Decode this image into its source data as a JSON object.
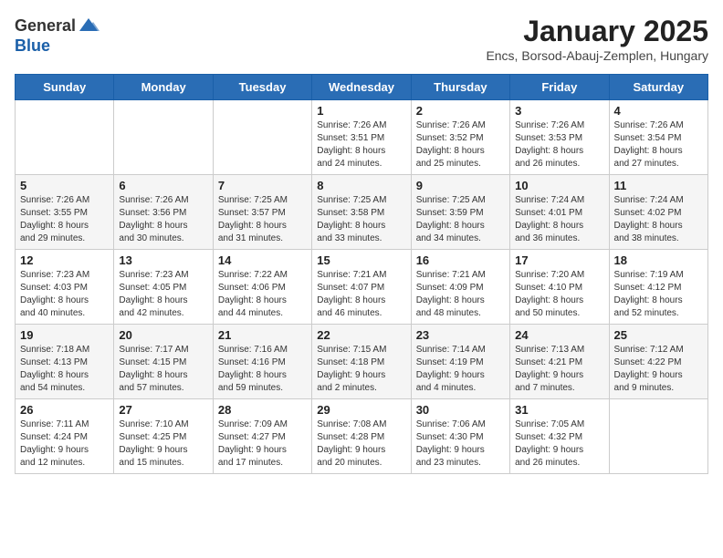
{
  "header": {
    "logo_general": "General",
    "logo_blue": "Blue",
    "month_title": "January 2025",
    "location": "Encs, Borsod-Abauj-Zemplen, Hungary"
  },
  "weekdays": [
    "Sunday",
    "Monday",
    "Tuesday",
    "Wednesday",
    "Thursday",
    "Friday",
    "Saturday"
  ],
  "weeks": [
    [
      {
        "day": "",
        "info": ""
      },
      {
        "day": "",
        "info": ""
      },
      {
        "day": "",
        "info": ""
      },
      {
        "day": "1",
        "info": "Sunrise: 7:26 AM\nSunset: 3:51 PM\nDaylight: 8 hours\nand 24 minutes."
      },
      {
        "day": "2",
        "info": "Sunrise: 7:26 AM\nSunset: 3:52 PM\nDaylight: 8 hours\nand 25 minutes."
      },
      {
        "day": "3",
        "info": "Sunrise: 7:26 AM\nSunset: 3:53 PM\nDaylight: 8 hours\nand 26 minutes."
      },
      {
        "day": "4",
        "info": "Sunrise: 7:26 AM\nSunset: 3:54 PM\nDaylight: 8 hours\nand 27 minutes."
      }
    ],
    [
      {
        "day": "5",
        "info": "Sunrise: 7:26 AM\nSunset: 3:55 PM\nDaylight: 8 hours\nand 29 minutes."
      },
      {
        "day": "6",
        "info": "Sunrise: 7:26 AM\nSunset: 3:56 PM\nDaylight: 8 hours\nand 30 minutes."
      },
      {
        "day": "7",
        "info": "Sunrise: 7:25 AM\nSunset: 3:57 PM\nDaylight: 8 hours\nand 31 minutes."
      },
      {
        "day": "8",
        "info": "Sunrise: 7:25 AM\nSunset: 3:58 PM\nDaylight: 8 hours\nand 33 minutes."
      },
      {
        "day": "9",
        "info": "Sunrise: 7:25 AM\nSunset: 3:59 PM\nDaylight: 8 hours\nand 34 minutes."
      },
      {
        "day": "10",
        "info": "Sunrise: 7:24 AM\nSunset: 4:01 PM\nDaylight: 8 hours\nand 36 minutes."
      },
      {
        "day": "11",
        "info": "Sunrise: 7:24 AM\nSunset: 4:02 PM\nDaylight: 8 hours\nand 38 minutes."
      }
    ],
    [
      {
        "day": "12",
        "info": "Sunrise: 7:23 AM\nSunset: 4:03 PM\nDaylight: 8 hours\nand 40 minutes."
      },
      {
        "day": "13",
        "info": "Sunrise: 7:23 AM\nSunset: 4:05 PM\nDaylight: 8 hours\nand 42 minutes."
      },
      {
        "day": "14",
        "info": "Sunrise: 7:22 AM\nSunset: 4:06 PM\nDaylight: 8 hours\nand 44 minutes."
      },
      {
        "day": "15",
        "info": "Sunrise: 7:21 AM\nSunset: 4:07 PM\nDaylight: 8 hours\nand 46 minutes."
      },
      {
        "day": "16",
        "info": "Sunrise: 7:21 AM\nSunset: 4:09 PM\nDaylight: 8 hours\nand 48 minutes."
      },
      {
        "day": "17",
        "info": "Sunrise: 7:20 AM\nSunset: 4:10 PM\nDaylight: 8 hours\nand 50 minutes."
      },
      {
        "day": "18",
        "info": "Sunrise: 7:19 AM\nSunset: 4:12 PM\nDaylight: 8 hours\nand 52 minutes."
      }
    ],
    [
      {
        "day": "19",
        "info": "Sunrise: 7:18 AM\nSunset: 4:13 PM\nDaylight: 8 hours\nand 54 minutes."
      },
      {
        "day": "20",
        "info": "Sunrise: 7:17 AM\nSunset: 4:15 PM\nDaylight: 8 hours\nand 57 minutes."
      },
      {
        "day": "21",
        "info": "Sunrise: 7:16 AM\nSunset: 4:16 PM\nDaylight: 8 hours\nand 59 minutes."
      },
      {
        "day": "22",
        "info": "Sunrise: 7:15 AM\nSunset: 4:18 PM\nDaylight: 9 hours\nand 2 minutes."
      },
      {
        "day": "23",
        "info": "Sunrise: 7:14 AM\nSunset: 4:19 PM\nDaylight: 9 hours\nand 4 minutes."
      },
      {
        "day": "24",
        "info": "Sunrise: 7:13 AM\nSunset: 4:21 PM\nDaylight: 9 hours\nand 7 minutes."
      },
      {
        "day": "25",
        "info": "Sunrise: 7:12 AM\nSunset: 4:22 PM\nDaylight: 9 hours\nand 9 minutes."
      }
    ],
    [
      {
        "day": "26",
        "info": "Sunrise: 7:11 AM\nSunset: 4:24 PM\nDaylight: 9 hours\nand 12 minutes."
      },
      {
        "day": "27",
        "info": "Sunrise: 7:10 AM\nSunset: 4:25 PM\nDaylight: 9 hours\nand 15 minutes."
      },
      {
        "day": "28",
        "info": "Sunrise: 7:09 AM\nSunset: 4:27 PM\nDaylight: 9 hours\nand 17 minutes."
      },
      {
        "day": "29",
        "info": "Sunrise: 7:08 AM\nSunset: 4:28 PM\nDaylight: 9 hours\nand 20 minutes."
      },
      {
        "day": "30",
        "info": "Sunrise: 7:06 AM\nSunset: 4:30 PM\nDaylight: 9 hours\nand 23 minutes."
      },
      {
        "day": "31",
        "info": "Sunrise: 7:05 AM\nSunset: 4:32 PM\nDaylight: 9 hours\nand 26 minutes."
      },
      {
        "day": "",
        "info": ""
      }
    ]
  ]
}
